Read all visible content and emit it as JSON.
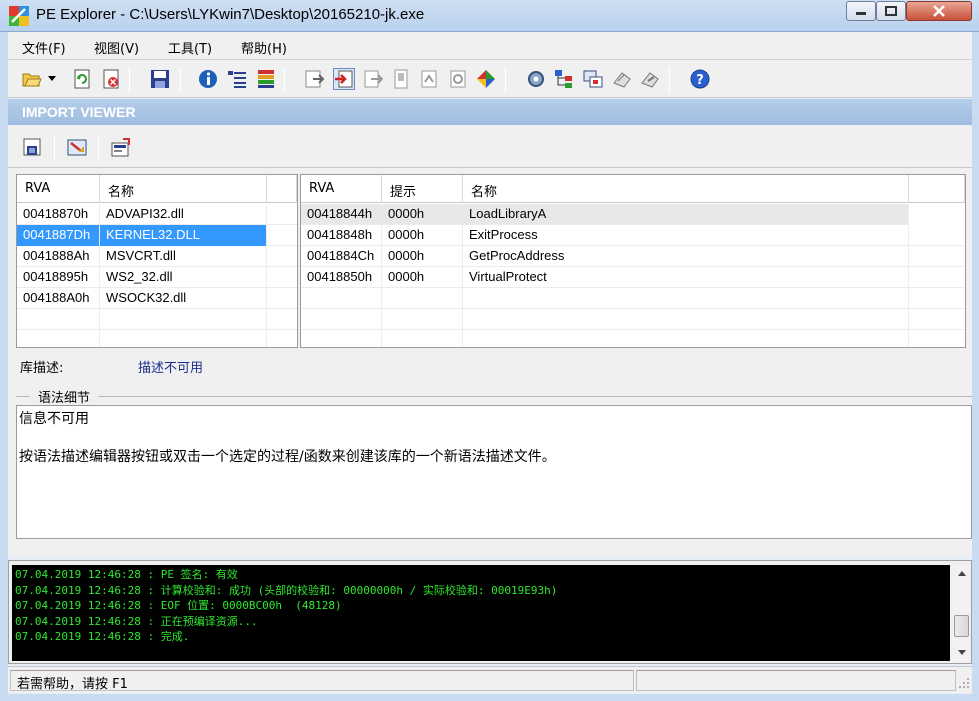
{
  "window": {
    "title": "PE Explorer - C:\\Users\\LYKwin7\\Desktop\\20165210-jk.exe"
  },
  "menu": [
    {
      "label": "文件(F)"
    },
    {
      "label": "视图(V)"
    },
    {
      "label": "工具(T)"
    },
    {
      "label": "帮助(H)"
    }
  ],
  "toolbar": {
    "icons": [
      "open-folder-icon",
      "dropdown-arrow-icon",
      "refresh-icon",
      "close-file-icon",
      "save-icon",
      "info-icon",
      "headers-icon",
      "data-directories-icon",
      "section-headers-icon",
      "imports-icon",
      "exports-icon",
      "resources-icon",
      "debug-icon",
      "dependencies-icon",
      "color-wheel-icon",
      "disassembler-icon",
      "dependency-scanner-icon",
      "resource-editor-icon",
      "syntax-editor-icon",
      "tools-icon",
      "help-icon"
    ]
  },
  "section": {
    "title": "IMPORT VIEWER"
  },
  "libraries": {
    "headers": [
      "RVA",
      "名称"
    ],
    "rows": [
      {
        "rva": "00418870h",
        "name": "ADVAPI32.dll"
      },
      {
        "rva": "0041887Dh",
        "name": "KERNEL32.DLL"
      },
      {
        "rva": "0041888Ah",
        "name": "MSVCRT.dll"
      },
      {
        "rva": "00418895h",
        "name": "WS2_32.dll"
      },
      {
        "rva": "004188A0h",
        "name": "WSOCK32.dll"
      }
    ],
    "selected_index": 1
  },
  "functions": {
    "headers": [
      "RVA",
      "提示",
      "名称"
    ],
    "rows": [
      {
        "rva": "00418844h",
        "hint": "0000h",
        "name": "LoadLibraryA"
      },
      {
        "rva": "00418848h",
        "hint": "0000h",
        "name": "ExitProcess"
      },
      {
        "rva": "0041884Ch",
        "hint": "0000h",
        "name": "GetProcAddress"
      },
      {
        "rva": "00418850h",
        "hint": "0000h",
        "name": "VirtualProtect"
      }
    ]
  },
  "library_description": {
    "label": "库描述:",
    "value": "描述不可用"
  },
  "syntax_details": {
    "title": "语法细节",
    "line1": "信息不可用",
    "line2": "按语法描述编辑器按钮或双击一个选定的过程/函数来创建该库的一个新语法描述文件。"
  },
  "log": {
    "lines": [
      "07.04.2019 12:46:28 : PE 签名: 有效",
      "07.04.2019 12:46:28 : 计算校验和: 成功 (头部的校验和: 00000000h / 实际校验和: 00019E93h)",
      "07.04.2019 12:46:28 : EOF 位置: 0000BC00h  (48128)",
      "07.04.2019 12:46:28 : 正在预编译资源...",
      "07.04.2019 12:46:28 : 完成."
    ]
  },
  "status": {
    "text": "若需帮助，请按 F1"
  }
}
